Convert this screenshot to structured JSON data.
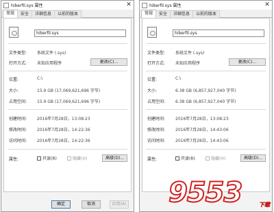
{
  "left_window": {
    "title": "hiberfil.sys 属性",
    "close": "✕",
    "tabs": [
      "常规",
      "安全",
      "详细信息",
      "以前的版本"
    ],
    "file_name": "hiberfil.sys",
    "type_label": "文件类型:",
    "type_value": "系统文件 (.sys)",
    "open_with_label": "打开方式:",
    "open_with_value": "未知应用程序",
    "change_button": "更改(C)...",
    "location_label": "位置:",
    "location_value": "C:\\",
    "size_label": "大小:",
    "size_value": "15.9 GB (17,069,621,696 字节)",
    "disk_size_label": "占用空间:",
    "disk_size_value": "15.9 GB (17,069,621,696 字节)",
    "created_label": "创建时间:",
    "created_value": "2016年7月28日，13:08:23",
    "modified_label": "修改时间:",
    "modified_value": "2016年7月28日，14:22:36",
    "accessed_label": "访问时间:",
    "accessed_value": "2016年7月28日，14:22:36",
    "attributes_label": "属性:",
    "readonly_label": "只读(R)",
    "hidden_label": "隐藏(H)",
    "advanced_button": "高级(D)..."
  },
  "right_window": {
    "title": "hiberfil.sys 属性",
    "close": "✕",
    "tabs": [
      "常规",
      "安全",
      "详细信息",
      "以前的版本"
    ],
    "file_name": "hiberfil.sys",
    "type_label": "文件类型:",
    "type_value": "系统文件 (.sys)",
    "open_with_label": "打开方式:",
    "open_with_value": "未知应用程序",
    "change_button": "更改(C)...",
    "location_label": "位置:",
    "location_value": "C:\\",
    "size_label": "大小:",
    "size_value": "6.38 GB (6,857,927,040 字节)",
    "disk_size_label": "占用空间:",
    "disk_size_value": "6.38 GB (6,857,927,040 字节)",
    "created_label": "创建时间:",
    "created_value": "2016年7月28日，13:08:23",
    "modified_label": "修改时间:",
    "modified_value": "2016年7月28日，14:43:06",
    "accessed_label": "访问时间:",
    "accessed_value": "2016年7月28日，14:43:06",
    "attributes_label": "属性:",
    "readonly_label": "只读(R)",
    "hidden_label": "隐藏(H)",
    "advanced_button": "高级(D)..."
  },
  "dialog_buttons": {
    "ok": "确定",
    "cancel": "取消",
    "apply": "应用(A)"
  },
  "watermark": {
    "brand": "9553",
    "sub": "下载"
  },
  "colors": {
    "watermark_stroke": "#d02020",
    "primary_button_border": "#3c7fb1"
  }
}
